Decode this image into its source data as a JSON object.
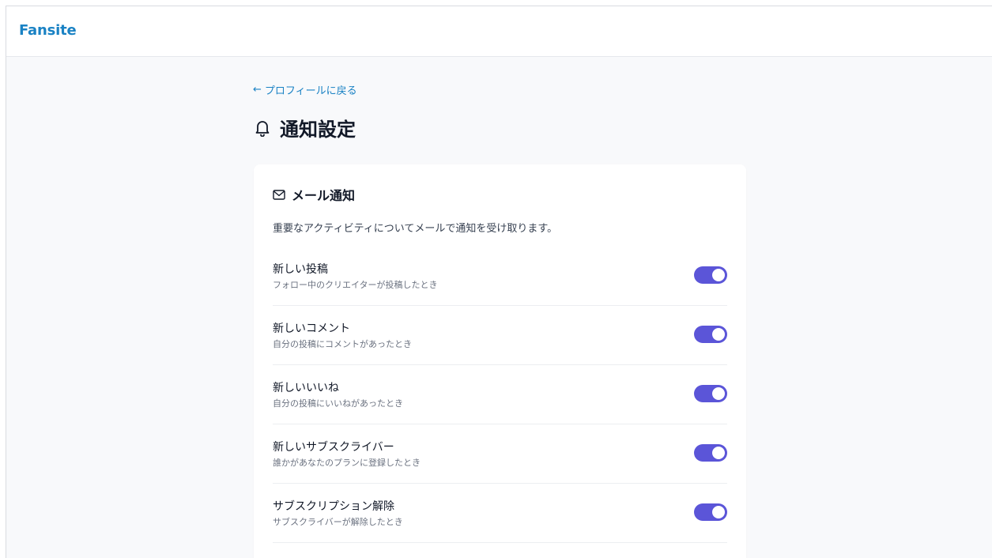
{
  "header": {
    "logo": "Fansite"
  },
  "page": {
    "back_link_arrow": "←",
    "back_link_label": "プロフィールに戻る",
    "title": "通知設定",
    "title_icon": "bell-icon"
  },
  "email_section": {
    "icon": "mail-icon",
    "title": "メール通知",
    "description": "重要なアクティビティについてメールで通知を受け取ります。",
    "items": [
      {
        "label": "新しい投稿",
        "sub": "フォロー中のクリエイターが投稿したとき",
        "enabled": true
      },
      {
        "label": "新しいコメント",
        "sub": "自分の投稿にコメントがあったとき",
        "enabled": true
      },
      {
        "label": "新しいいいね",
        "sub": "自分の投稿にいいねがあったとき",
        "enabled": true
      },
      {
        "label": "新しいサブスクライバー",
        "sub": "誰かがあなたのプランに登録したとき",
        "enabled": true
      },
      {
        "label": "サブスクリプション解除",
        "sub": "サブスクライバーが解除したとき",
        "enabled": true
      }
    ]
  },
  "colors": {
    "accent": "#1a82c4",
    "toggle_on": "#5b55d8",
    "background": "#f8f9fb"
  }
}
